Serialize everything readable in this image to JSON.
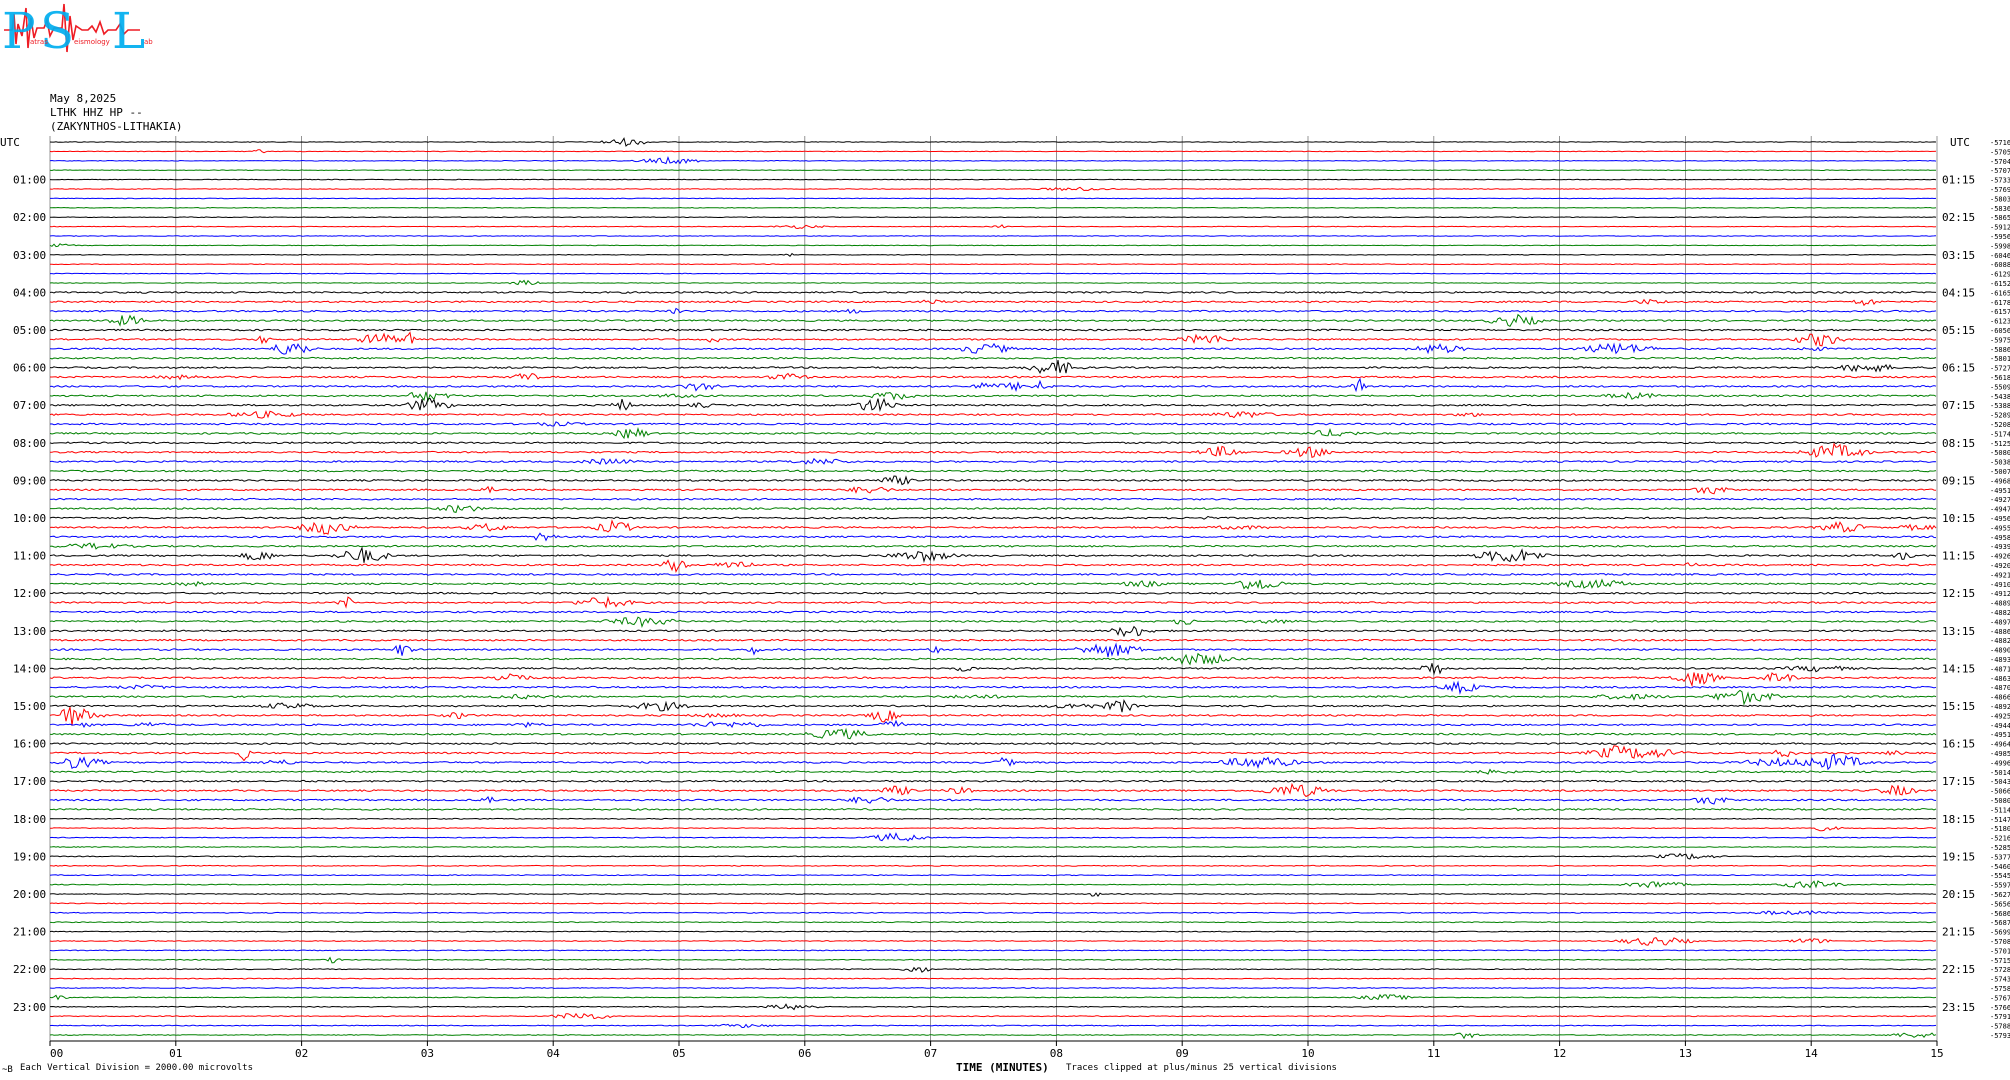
{
  "logo": {
    "big_letters": [
      "P",
      "S",
      "L"
    ],
    "small_text": [
      "atras",
      "eismology",
      "ab"
    ]
  },
  "header": {
    "date": "May 8,2025",
    "station": "LTHK HHZ HP --",
    "location": "(ZAKYNTHOS-LITHAKIA)"
  },
  "left_utc_label": "UTC",
  "right_utc_label": "UTC",
  "footer": {
    "left_note": "Each Vertical Division = 2000.00 microvolts",
    "x_title": "TIME (MINUTES)",
    "clip_note": "Traces clipped at plus/minus 25 vertical divisions",
    "corner_mark": "~B"
  },
  "chart_data": {
    "type": "line",
    "title": "May 8,2025 LTHK HHZ HP -- (ZAKYNTHOS-LITHAKIA)",
    "xlabel": "TIME (MINUTES)",
    "ylabel": "",
    "x_ticks": [
      "00",
      "01",
      "02",
      "03",
      "04",
      "05",
      "06",
      "07",
      "08",
      "09",
      "10",
      "11",
      "12",
      "13",
      "14",
      "15"
    ],
    "xlim": [
      0,
      15
    ],
    "trace_count": 96,
    "minutes_per_trace": 15,
    "trace_colors": [
      "#000000",
      "#ff0000",
      "#0000ff",
      "#008000"
    ],
    "left_hour_labels": [
      "01:00",
      "02:00",
      "03:00",
      "04:00",
      "05:00",
      "06:00",
      "07:00",
      "08:00",
      "09:00",
      "10:00",
      "11:00",
      "12:00",
      "13:00",
      "14:00",
      "15:00",
      "16:00",
      "17:00",
      "18:00",
      "19:00",
      "20:00",
      "21:00",
      "22:00",
      "23:00"
    ],
    "right_hour_labels": [
      "01:15",
      "02:15",
      "03:15",
      "04:15",
      "05:15",
      "06:15",
      "07:15",
      "08:15",
      "09:15",
      "10:15",
      "11:15",
      "12:15",
      "13:15",
      "14:15",
      "15:15",
      "16:15",
      "17:15",
      "18:15",
      "19:15",
      "20:15",
      "21:15",
      "22:15",
      "23:15"
    ],
    "trace_offsets": [
      "-5716",
      "-5705",
      "-5704",
      "-5707",
      "-5733",
      "-5769",
      "-5803",
      "-5836",
      "-5865",
      "-5912",
      "-5956",
      "-5998",
      "-6046",
      "-6088",
      "-6129",
      "-6152",
      "-6165",
      "-6178",
      "-6157",
      "-6123",
      "-6056",
      "-5975",
      "-5886",
      "-5801",
      "-5727",
      "-5618",
      "-5509",
      "-5438",
      "-5388",
      "-5289",
      "-5208",
      "-5174",
      "-5125",
      "-5080",
      "-5038",
      "-5007",
      "-4968",
      "-4951",
      "-4927",
      "-4947",
      "-4956",
      "-4955",
      "-4958",
      "-4939",
      "-4926",
      "-4920",
      "-4921",
      "-4910",
      "-4912",
      "-4889",
      "-4882",
      "-4897",
      "-4886",
      "-4882",
      "-4890",
      "-4893",
      "-4871",
      "-4863",
      "-4870",
      "-4866",
      "-4892",
      "-4925",
      "-4944",
      "-4951",
      "-4964",
      "-4985",
      "-4996",
      "-5014",
      "-5043",
      "-5066",
      "-5080",
      "-5114",
      "-5147",
      "-5180",
      "-5216",
      "-5285",
      "-5377",
      "-5460",
      "-5545",
      "-5597",
      "-5627",
      "-5656",
      "-5686",
      "-5687",
      "-5699",
      "-5708",
      "-5701",
      "-5715",
      "-5728",
      "-5743",
      "-5758",
      "-5767",
      "-5766",
      "-5791",
      "-5788",
      "-5793"
    ]
  }
}
